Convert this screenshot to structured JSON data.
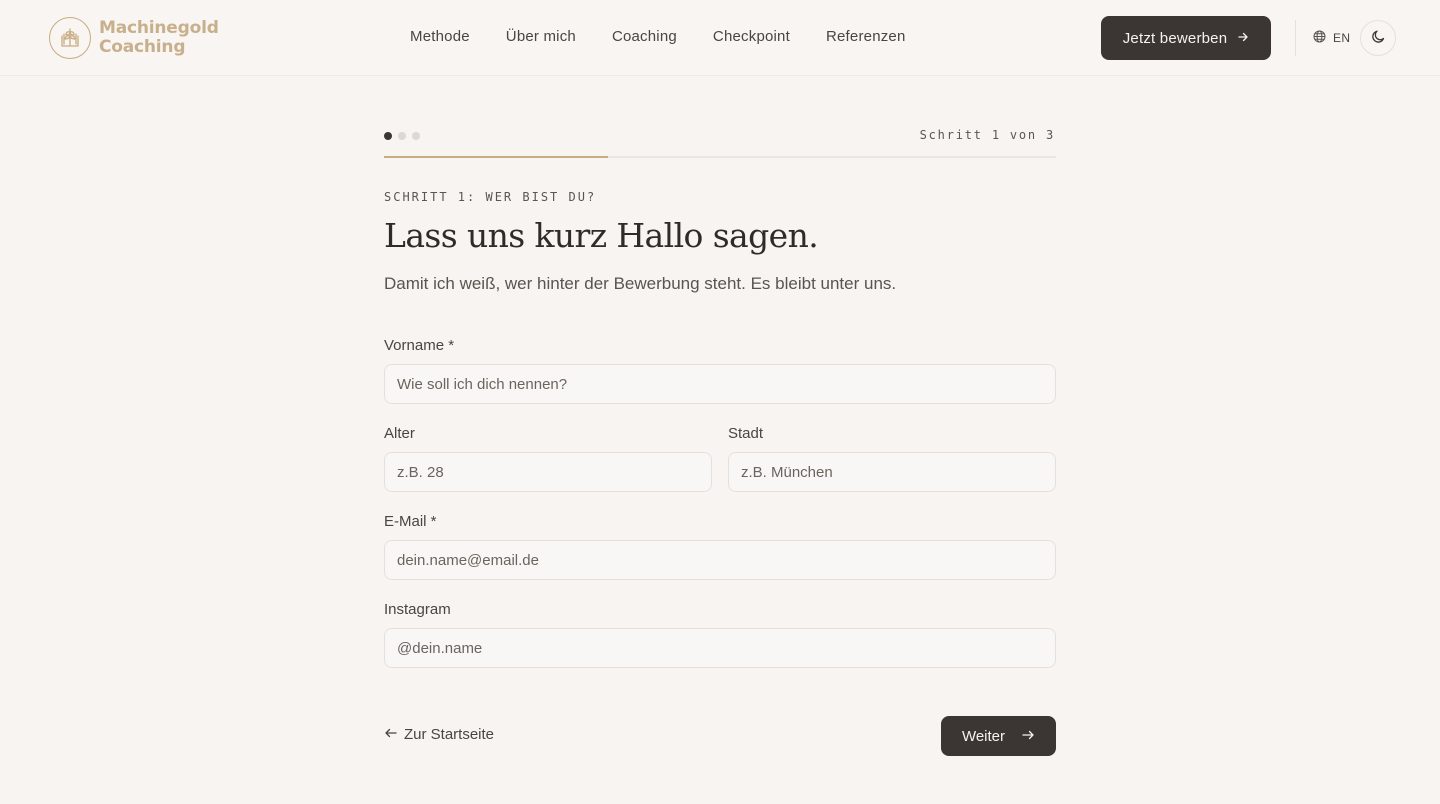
{
  "brand": {
    "line1": "Machinegold",
    "line2": "Coaching",
    "logo_icon": "wheat-book-logo-icon",
    "accent_color": "#c8ac82"
  },
  "nav": {
    "items": [
      {
        "label": "Methode"
      },
      {
        "label": "Über mich"
      },
      {
        "label": "Coaching"
      },
      {
        "label": "Checkpoint"
      },
      {
        "label": "Referenzen"
      }
    ]
  },
  "header": {
    "apply_label": "Jetzt bewerben",
    "apply_icon": "arrow-right-icon",
    "lang_label": "EN",
    "lang_icon": "globe-icon",
    "theme_icon": "moon-icon",
    "button_color": "#3b3633"
  },
  "progress": {
    "step_text": "Schritt 1 von 3",
    "current_step": 1,
    "total_steps": 3,
    "fraction": 0.333
  },
  "step": {
    "eyebrow": "SCHRITT 1: WER BIST DU?",
    "title": "Lass uns kurz Hallo sagen.",
    "subtitle": "Damit ich weiß, wer hinter der Bewerbung steht. Es bleibt unter uns."
  },
  "form": {
    "first_name": {
      "label": "Vorname *",
      "placeholder": "Wie soll ich dich nennen?",
      "value": ""
    },
    "age": {
      "label": "Alter",
      "placeholder": "z.B. 28",
      "value": ""
    },
    "city": {
      "label": "Stadt",
      "placeholder": "z.B. München",
      "value": ""
    },
    "email": {
      "label": "E-Mail *",
      "placeholder": "dein.name@email.de",
      "value": ""
    },
    "instagram": {
      "label": "Instagram",
      "placeholder": "@dein.name",
      "value": ""
    }
  },
  "actions": {
    "back_label": "Zur Startseite",
    "back_icon": "arrow-left-icon",
    "next_label": "Weiter",
    "next_icon": "arrow-right-icon"
  }
}
